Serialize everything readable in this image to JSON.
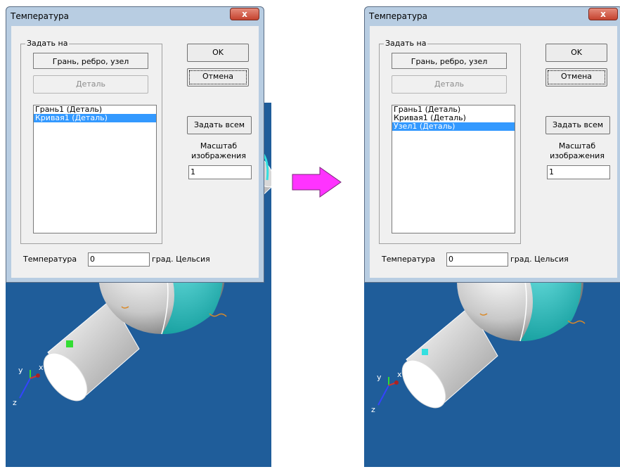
{
  "left": {
    "dialog": {
      "title": "Температура",
      "close_label": "x",
      "group_label": "Задать на",
      "mode_value": "Грань, ребро, узел",
      "detail_button": "Деталь",
      "ok_button": "OK",
      "cancel_button": "Отмена",
      "set_all_button": "Задать всем",
      "scale_label_1": "Масштаб",
      "scale_label_2": "изображения",
      "scale_value": "1",
      "temperature_label": "Температура",
      "temperature_value": "0",
      "unit_label": "град. Цельсия",
      "list_items": [
        "Грань1 (Деталь)",
        "Кривая1 (Деталь)"
      ],
      "selected_index": 1
    },
    "axes": {
      "x": "x",
      "y": "y",
      "z": "z"
    }
  },
  "right": {
    "dialog": {
      "title": "Температура",
      "close_label": "x",
      "group_label": "Задать на",
      "mode_value": "Грань, ребро, узел",
      "detail_button": "Деталь",
      "ok_button": "OK",
      "cancel_button": "Отмена",
      "set_all_button": "Задать всем",
      "scale_label_1": "Масштаб",
      "scale_label_2": "изображения",
      "scale_value": "1",
      "temperature_label": "Температура",
      "temperature_value": "0",
      "unit_label": "град. Цельсия",
      "list_items": [
        "Грань1 (Деталь)",
        "Кривая1 (Деталь)",
        "Узел1 (Деталь)"
      ],
      "selected_index": 2
    },
    "axes": {
      "x": "x",
      "y": "y",
      "z": "z"
    }
  },
  "colors": {
    "viewport_bg": "#1f5d9a",
    "sphere_teal": "#1fbfbf",
    "selection": "#3399ff",
    "arrow_fill": "#ff33ff",
    "highlight_edge": "#33dd33",
    "highlight_node": "#33e0e0"
  },
  "icons": {
    "arrow": "right-arrow-icon",
    "close": "close-icon"
  }
}
